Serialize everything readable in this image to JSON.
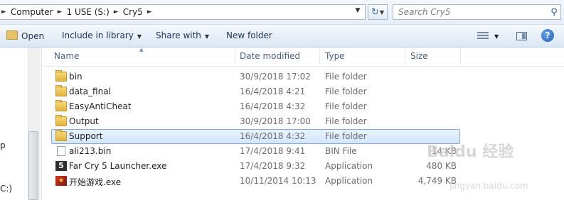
{
  "address": {
    "crumbs": [
      "Computer",
      "1 USE (S:)",
      "Cry5"
    ]
  },
  "search": {
    "placeholder": "Search Cry5"
  },
  "toolbar": {
    "open": "Open",
    "include_in_library": "Include in library",
    "share_with": "Share with",
    "new_folder": "New folder"
  },
  "columns": {
    "name": "Name",
    "date": "Date modified",
    "type": "Type",
    "size": "Size"
  },
  "nav": {
    "partial_p": "p",
    "partial_c": "C:)"
  },
  "files": [
    {
      "name": "bin",
      "date": "30/9/2018 17:02",
      "type": "File folder",
      "size": "",
      "icon": "folder-icon"
    },
    {
      "name": "data_final",
      "date": "16/4/2018 4:21",
      "type": "File folder",
      "size": "",
      "icon": "folder-icon"
    },
    {
      "name": "EasyAntiCheat",
      "date": "16/4/2018 4:32",
      "type": "File folder",
      "size": "",
      "icon": "folder-icon"
    },
    {
      "name": "Output",
      "date": "30/9/2018 17:00",
      "type": "File folder",
      "size": "",
      "icon": "folder-icon"
    },
    {
      "name": "Support",
      "date": "16/4/2018 4:32",
      "type": "File folder",
      "size": "",
      "icon": "folder-icon",
      "selected": true
    },
    {
      "name": "ali213.bin",
      "date": "17/4/2018 9:41",
      "type": "BIN File",
      "size": "14 KB",
      "icon": "file-icon"
    },
    {
      "name": "Far Cry 5 Launcher.exe",
      "date": "17/4/2018 9:32",
      "type": "Application",
      "size": "480 KB",
      "icon": "far-cry-5-icon"
    },
    {
      "name": "开始游戏.exe",
      "date": "10/11/2014 10:13",
      "type": "Application",
      "size": "4,749 KB",
      "icon": "game-launcher-icon"
    }
  ],
  "watermark": {
    "brand": "Baidu 经验",
    "url": "jingyan.baidu.com"
  }
}
